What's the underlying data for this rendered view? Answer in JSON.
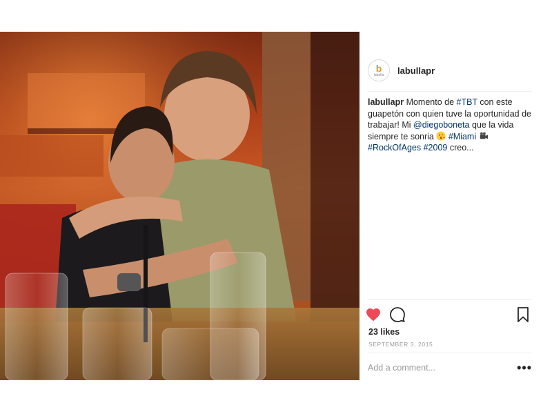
{
  "post": {
    "username": "labullapr",
    "avatar": {
      "glyph": "b",
      "word": "labulla"
    },
    "caption": [
      {
        "type": "user",
        "text": "labullapr"
      },
      {
        "type": "text",
        "text": " Momento de "
      },
      {
        "type": "link",
        "text": "#TBT"
      },
      {
        "type": "text",
        "text": " con este guapetón con quien tuve la oportunidad de trabajar! Mi "
      },
      {
        "type": "link",
        "text": "@diegoboneta"
      },
      {
        "type": "text",
        "text": " que la vida siempre te sonria "
      },
      {
        "type": "emoji",
        "icon": "kissing-face-emoji"
      },
      {
        "type": "text",
        "text": " "
      },
      {
        "type": "link",
        "text": "#Miami"
      },
      {
        "type": "text",
        "text": " "
      },
      {
        "type": "emoji",
        "icon": "movie-camera-emoji"
      },
      {
        "type": "text",
        "text": " "
      },
      {
        "type": "link",
        "text": "#RockOfAges"
      },
      {
        "type": "text",
        "text": " "
      },
      {
        "type": "link",
        "text": "#2009"
      },
      {
        "type": "text",
        "text": " creo..."
      }
    ],
    "likes": "23 likes",
    "date": "SEPTEMBER 3, 2015",
    "comment_placeholder": "Add a comment...",
    "more_label": "•••",
    "icons": {
      "like": "heart-filled-icon",
      "comment": "comment-bubble-icon",
      "save": "bookmark-icon",
      "more": "more-options-icon"
    },
    "colors": {
      "like_red": "#ed4956",
      "link_blue": "#003569",
      "muted": "#999999",
      "text": "#262626"
    }
  }
}
